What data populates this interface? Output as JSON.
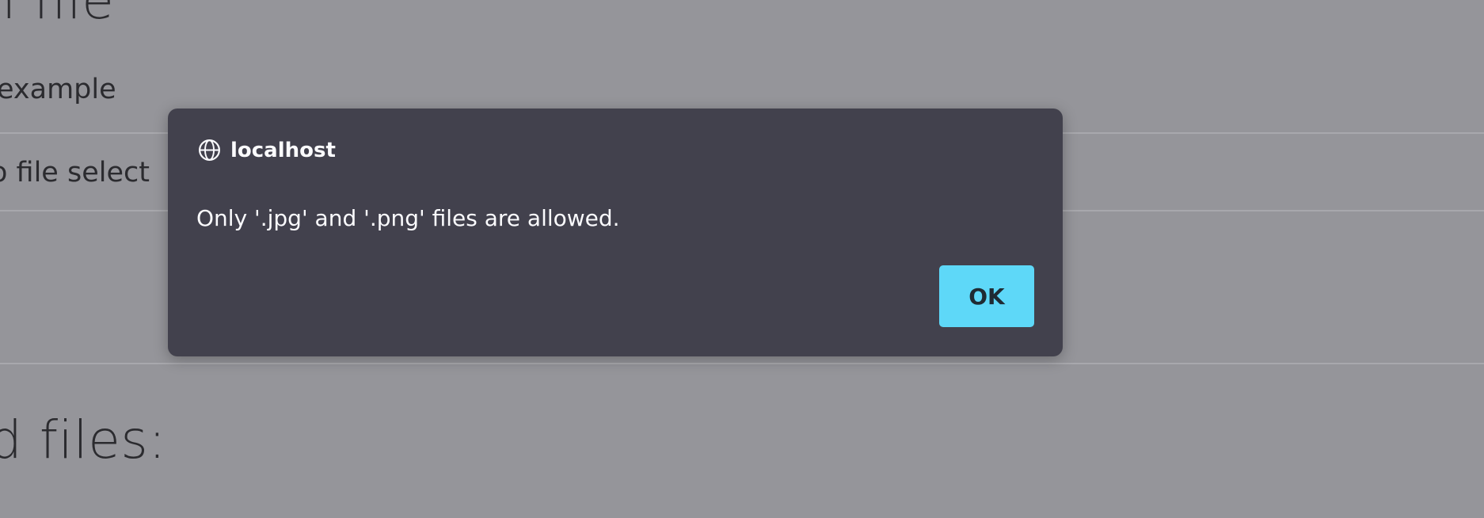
{
  "background_page": {
    "title_fragment": "n file",
    "label_fragment": "example",
    "file_status_fragment": "o file select",
    "heading_fragment": "d files:"
  },
  "dialog": {
    "icon": "globe-icon",
    "origin": "localhost",
    "message": "Only '.jpg' and '.png' files are allowed.",
    "ok_label": "OK",
    "accent_color": "#5ed8f8"
  }
}
